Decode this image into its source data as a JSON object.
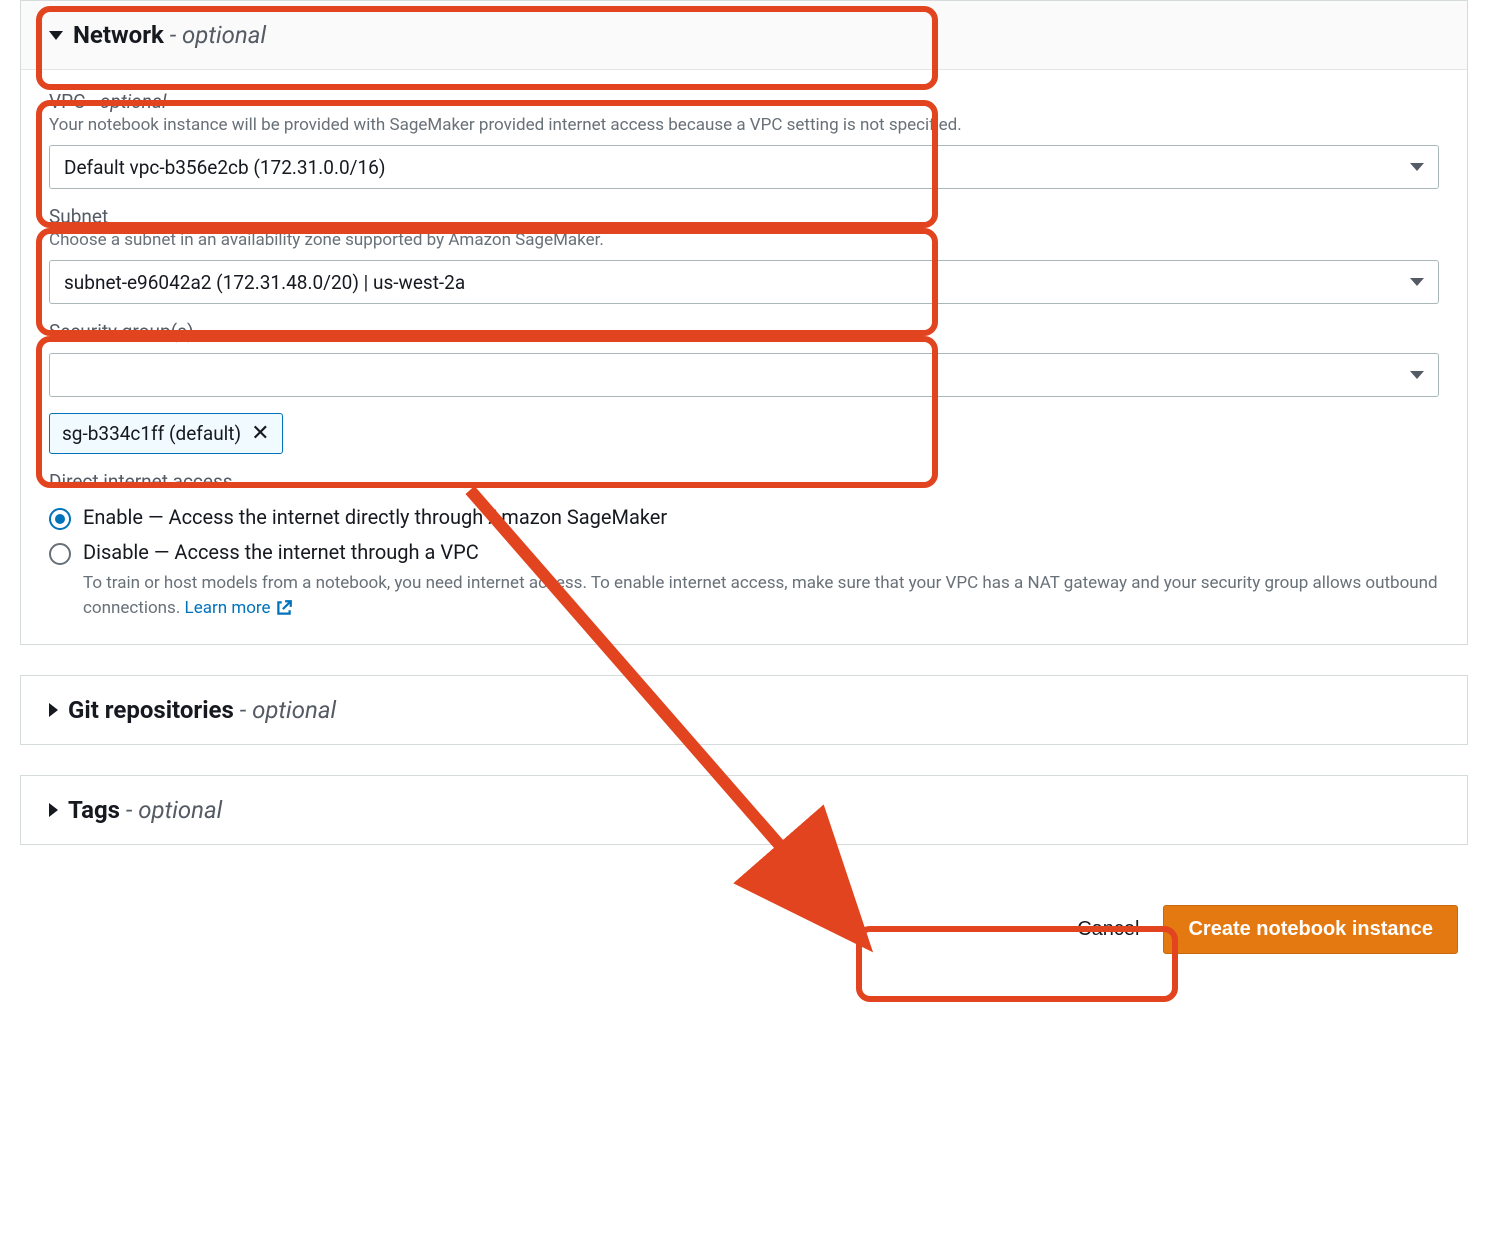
{
  "sections": {
    "network": {
      "title": "Network",
      "optional_suffix": " - optional",
      "expanded": true,
      "vpc": {
        "label": "VPC",
        "optional_suffix": " - optional",
        "help": "Your notebook instance will be provided with SageMaker provided internet access because a VPC setting is not specified.",
        "selected": "Default vpc-b356e2cb (172.31.0.0/16)"
      },
      "subnet": {
        "label": "Subnet",
        "help": "Choose a subnet in an availability zone supported by Amazon SageMaker.",
        "selected": "subnet-e96042a2 (172.31.48.0/20) | us-west-2a"
      },
      "security_groups": {
        "label": "Security group(s)",
        "selected": "",
        "token": "sg-b334c1ff (default)"
      },
      "internet_access": {
        "label": "Direct internet access",
        "options": [
          {
            "label": "Enable — Access the internet directly through Amazon SageMaker",
            "selected": true
          },
          {
            "label": "Disable — Access the internet through a VPC",
            "selected": false
          }
        ],
        "disable_help": "To train or host models from a notebook, you need internet access. To enable internet access, make sure that your VPC has a NAT gateway and your security group allows outbound connections. ",
        "learn_more": "Learn more"
      }
    },
    "git": {
      "title": "Git repositories",
      "optional_suffix": " - optional",
      "expanded": false
    },
    "tags": {
      "title": "Tags",
      "optional_suffix": " - optional",
      "expanded": false
    }
  },
  "footer": {
    "cancel": "Cancel",
    "create": "Create notebook instance"
  },
  "annotation": {
    "highlight_color": "#e1441e"
  }
}
